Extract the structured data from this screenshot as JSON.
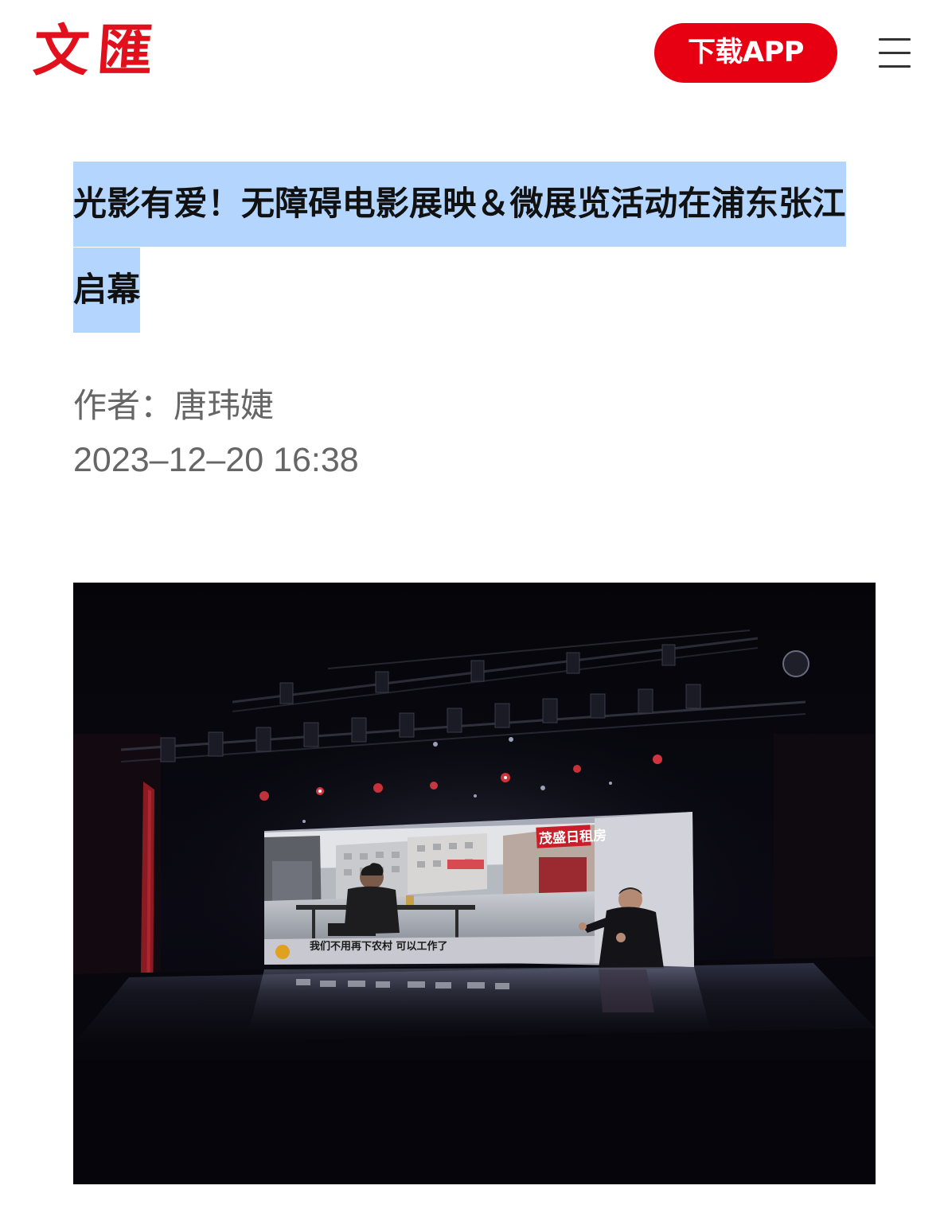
{
  "header": {
    "logo_text": "文匯",
    "download_label": "下载APP",
    "menu_icon": "hamburger-menu-icon"
  },
  "article": {
    "title": "光影有爱！无障碍电影展映＆微展览活动在浦东张江启幕",
    "author": "作者：唐玮婕",
    "published": "2023–12–20 16:38"
  },
  "photo": {
    "screen_subtitle": "我们不用再下农村 可以工作了",
    "screen_sign": "茂盛日租房"
  },
  "colors": {
    "brand_red": "#e60012",
    "title_highlight": "#b4d6fe",
    "meta_gray": "#666666"
  }
}
